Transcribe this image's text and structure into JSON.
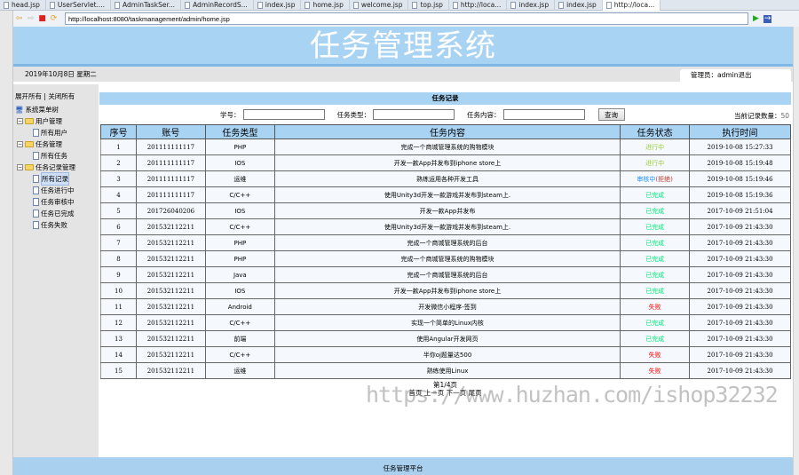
{
  "browser": {
    "tabs": [
      "head.jsp",
      "UserServlet....",
      "AdminTaskSer...",
      "AdminRecordS...",
      "index.jsp",
      "home.jsp",
      "welcome.jsp",
      "top.jsp",
      "http://loca...",
      "index.jsp",
      "index.jsp",
      "http://loca..."
    ],
    "active_tab": 11,
    "url": "http://localhost:8080/taskmanagement/admin/home.jsp"
  },
  "header": {
    "title": "任务管理系统",
    "date": "2019年10月8日 星期二",
    "admin_label": "管理员：",
    "admin_name": "admin",
    "logout": "退出"
  },
  "sidebar": {
    "expand_all": "展开所有",
    "separator": "|",
    "collapse_all": "关闭所有",
    "root": "系统菜单树",
    "groups": [
      {
        "label": "用户管理",
        "items": [
          "所有用户"
        ]
      },
      {
        "label": "任务管理",
        "items": [
          "所有任务"
        ]
      },
      {
        "label": "任务记录管理",
        "items": [
          "所有记录",
          "任务进行中",
          "任务审核中",
          "任务已完成",
          "任务失败"
        ]
      }
    ]
  },
  "main": {
    "section_title": "任务记录",
    "search": {
      "student_id_label": "学号：",
      "type_label": "任务类型：",
      "content_label": "任务内容：",
      "query_button": "查询",
      "count_label": "当前记录数量：",
      "count": "50"
    },
    "columns": [
      "序号",
      "账号",
      "任务类型",
      "任务内容",
      "任务状态",
      "执行时间"
    ],
    "rows": [
      {
        "no": "1",
        "account": "201111111117",
        "type": "PHP",
        "content": "完成一个商城管理系统的购物模块",
        "status": "进行中",
        "status_key": "progress",
        "time": "2019-10-08 15:27:33"
      },
      {
        "no": "2",
        "account": "201111111117",
        "type": "IOS",
        "content": "开发一款App并发布到iphone store上",
        "status": "进行中",
        "status_key": "progress",
        "time": "2019-10-08 15:19:48"
      },
      {
        "no": "3",
        "account": "201111111117",
        "type": "运维",
        "content": "熟练运用各种开发工具",
        "status": "审核中",
        "status_extra": "(拒绝)",
        "status_key": "review",
        "time": "2019-10-08 15:19:46"
      },
      {
        "no": "4",
        "account": "201111111117",
        "type": "C/C++",
        "content": "使用Unity3d开发一款游戏并发布到steam上.",
        "status": "已完成",
        "status_key": "done",
        "time": "2019-10-08 15:19:36"
      },
      {
        "no": "5",
        "account": "201726040206",
        "type": "IOS",
        "content": "开发一款App并发布",
        "status": "已完成",
        "status_key": "done",
        "time": "2017-10-09 21:51:04"
      },
      {
        "no": "6",
        "account": "201532112211",
        "type": "C/C++",
        "content": "使用Unity3d开发一款游戏并发布到steam上.",
        "status": "已完成",
        "status_key": "done",
        "time": "2017-10-09 21:43:30"
      },
      {
        "no": "7",
        "account": "201532112211",
        "type": "PHP",
        "content": "完成一个商城管理系统的后台",
        "status": "已完成",
        "status_key": "done",
        "time": "2017-10-09 21:43:30"
      },
      {
        "no": "8",
        "account": "201532112211",
        "type": "PHP",
        "content": "完成一个商城管理系统的购物模块",
        "status": "已完成",
        "status_key": "done",
        "time": "2017-10-09 21:43:30"
      },
      {
        "no": "9",
        "account": "201532112211",
        "type": "Java",
        "content": "完成一个商城管理系统的后台",
        "status": "已完成",
        "status_key": "done",
        "time": "2017-10-09 21:43:30"
      },
      {
        "no": "10",
        "account": "201532112211",
        "type": "IOS",
        "content": "开发一款App并发布到iphone store上",
        "status": "已完成",
        "status_key": "done",
        "time": "2017-10-09 21:43:30"
      },
      {
        "no": "11",
        "account": "201532112211",
        "type": "Android",
        "content": "开发微信小程序-签到",
        "status": "失败",
        "status_key": "fail",
        "time": "2017-10-09 21:43:30"
      },
      {
        "no": "12",
        "account": "201532112211",
        "type": "C/C++",
        "content": "实现一个简单的Linux内核",
        "status": "已完成",
        "status_key": "done",
        "time": "2017-10-09 21:43:30"
      },
      {
        "no": "13",
        "account": "201532112211",
        "type": "前端",
        "content": "使用Angular开发网页",
        "status": "已完成",
        "status_key": "done",
        "time": "2017-10-09 21:43:30"
      },
      {
        "no": "14",
        "account": "201532112211",
        "type": "C/C++",
        "content": "半你oj题量达500",
        "status": "失败",
        "status_key": "fail",
        "time": "2017-10-09 21:43:30"
      },
      {
        "no": "15",
        "account": "201532112211",
        "type": "运维",
        "content": "熟练使用Linux",
        "status": "失败",
        "status_key": "fail",
        "time": "2017-10-09 21:43:30"
      }
    ],
    "pager": {
      "page_info": "第1/4页",
      "first": "首页",
      "prev": "上一页",
      "next": "下一页",
      "last": "尾页"
    }
  },
  "status_colors": {
    "progress": "#9acd32",
    "review": "#1e90ff",
    "reject": "#c0392b",
    "done": "#00e676",
    "fail": "#ff0000"
  },
  "watermark": "https://www.huzhan.com/ishop32232",
  "footer": "任务管理平台"
}
